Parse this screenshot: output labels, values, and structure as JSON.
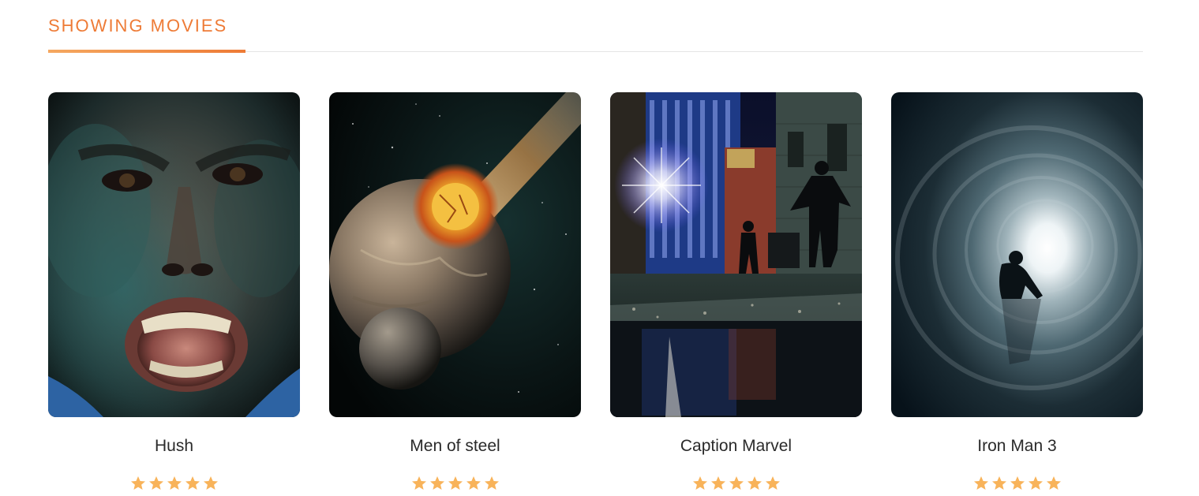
{
  "section": {
    "title": "SHOWING MOVIES",
    "accent_color": "#ee7b36"
  },
  "movies": [
    {
      "title": "Hush",
      "rating": 5,
      "max_rating": 5,
      "poster_icon": "screaming-face-poster"
    },
    {
      "title": "Men of steel",
      "rating": 5,
      "max_rating": 5,
      "poster_icon": "planet-impact-poster"
    },
    {
      "title": "Caption Marvel",
      "rating": 5,
      "max_rating": 5,
      "poster_icon": "city-alley-poster"
    },
    {
      "title": "Iron Man 3",
      "rating": 5,
      "max_rating": 5,
      "poster_icon": "tunnel-light-poster"
    }
  ],
  "colors": {
    "star": "#f8b35a",
    "title_text": "#2a2a2a"
  }
}
